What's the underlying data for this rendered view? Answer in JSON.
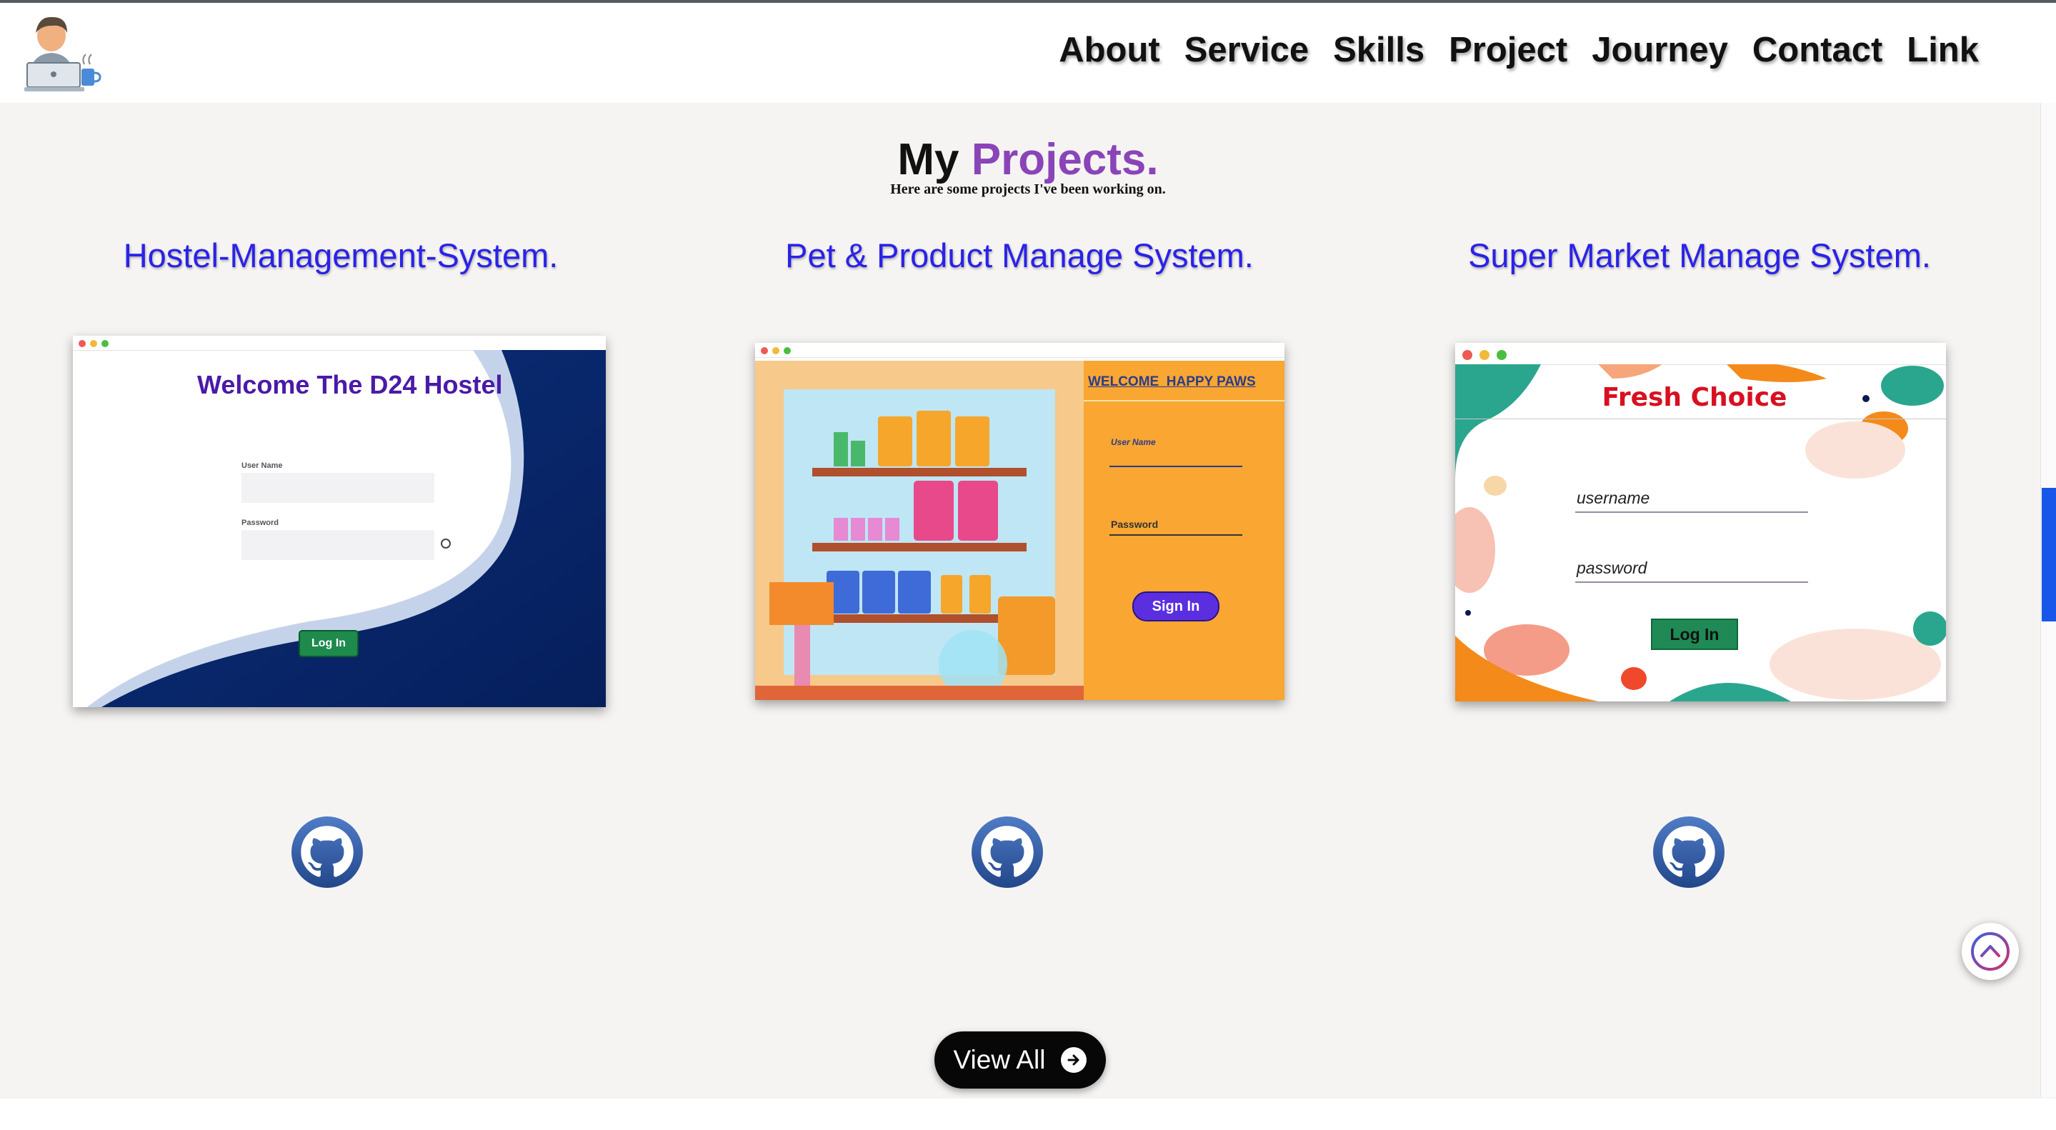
{
  "nav": {
    "items": [
      "About",
      "Service",
      "Skills",
      "Project",
      "Journey",
      "Contact",
      "Link"
    ]
  },
  "section": {
    "title_prefix": "My",
    "title_accent": "Projects.",
    "subtitle": "Here are some projects I've been working on."
  },
  "projects": [
    {
      "title": "Hostel-Management-System.",
      "screenshot": {
        "heading": "Welcome The D24 Hostel",
        "user_label": "User Name",
        "password_label": "Password",
        "button": "Log In"
      }
    },
    {
      "title": "Pet & Product Manage System.",
      "screenshot": {
        "heading": "WELCOME  HAPPY PAWS",
        "user_label": "User Name",
        "password_label": "Password",
        "button": "Sign In"
      }
    },
    {
      "title": "Super Market Manage System.",
      "screenshot": {
        "heading": "Fresh Choice",
        "user_label": "username",
        "password_label": "password",
        "button": "Log In"
      }
    }
  ],
  "view_all": {
    "label": "View All"
  },
  "icons": {
    "logo": "developer-avatar-icon",
    "github": "github-icon",
    "view_all_arrow": "arrow-right-circle-icon",
    "scroll_top": "chevron-up-circle-icon"
  },
  "colors": {
    "page_bg": "#f5f4f2",
    "title_accent": "#8a44b8",
    "project_title": "#2a22e8",
    "github_blue": "#2f5fa8",
    "scroll_tab": "#1756e8"
  }
}
